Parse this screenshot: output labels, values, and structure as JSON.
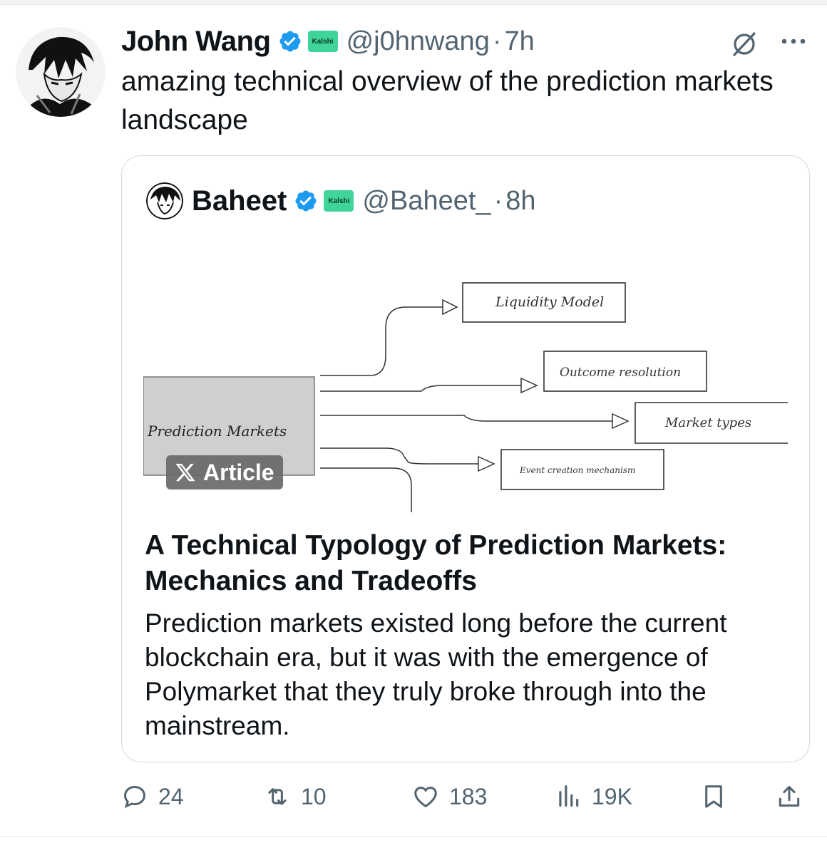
{
  "tweet": {
    "author_name": "John Wang",
    "author_handle": "@j0hnwang",
    "separator": "·",
    "time": "7h",
    "badge_label": "Kalshi",
    "text": "amazing technical overview of the prediction markets landscape"
  },
  "quote": {
    "author_name": "Baheet",
    "author_handle": "@Baheet_",
    "separator": "·",
    "time": "8h",
    "badge_label": "Kalshi",
    "article_badge": "Article",
    "diagram": {
      "root": "Prediction Markets",
      "branches": [
        "Liquidity Model",
        "Outcome resolution",
        "Market types",
        "Event creation mechanism"
      ]
    },
    "article_title": "A Technical Typology of Prediction Markets: Mechanics and Tradeoffs",
    "article_description": "Prediction markets existed long before the current blockchain era, but it was with the emergence of Polymarket that they truly broke through into the mainstream."
  },
  "actions": {
    "replies": "24",
    "reposts": "10",
    "likes": "183",
    "views": "19K"
  },
  "colors": {
    "verified": "#1d9bf0",
    "kalshi_badge": "#3fd49a",
    "muted_text": "#536471",
    "card_border": "#cfd9de"
  },
  "icons": [
    "grok-icon",
    "more-icon",
    "verified-icon",
    "reply-icon",
    "repost-icon",
    "like-icon",
    "views-icon",
    "bookmark-icon",
    "share-icon",
    "x-logo-icon"
  ]
}
